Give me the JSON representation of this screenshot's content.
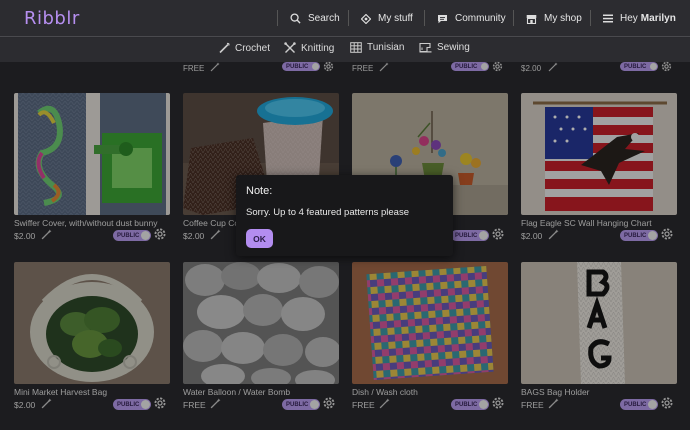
{
  "app": {
    "logo": "Ribblr"
  },
  "nav": {
    "search": "Search",
    "my_stuff": "My stuff",
    "community": "Community",
    "my_shop": "My shop",
    "greeting": "Hey",
    "username": "Marilyn"
  },
  "categories": [
    "Crochet",
    "Knitting",
    "Tunisian",
    "Sewing"
  ],
  "top_strip": [
    "FREE",
    "FREE",
    "$2.00"
  ],
  "badge_label": "PUBLIC",
  "cards": [
    {
      "title": "Swiffer Cover, with/without dust bunny",
      "price": "$2.00"
    },
    {
      "title": "Coffee Cup Cozy",
      "price": "$2.00"
    },
    {
      "title": "",
      "price": ""
    },
    {
      "title": "Flag Eagle SC Wall Hanging Chart",
      "price": "$2.00"
    },
    {
      "title": "Mini Market Harvest Bag",
      "price": "$2.00"
    },
    {
      "title": "Water Balloon / Water Bomb",
      "price": "FREE"
    },
    {
      "title": "Dish / Wash cloth",
      "price": "FREE"
    },
    {
      "title": "BAGS Bag Holder",
      "price": "FREE"
    }
  ],
  "modal": {
    "title": "Note:",
    "message": "Sorry. Up to 4 featured patterns please",
    "ok": "OK"
  },
  "colors": {
    "accent": "#b38df0",
    "background": "#2a2a2e"
  }
}
